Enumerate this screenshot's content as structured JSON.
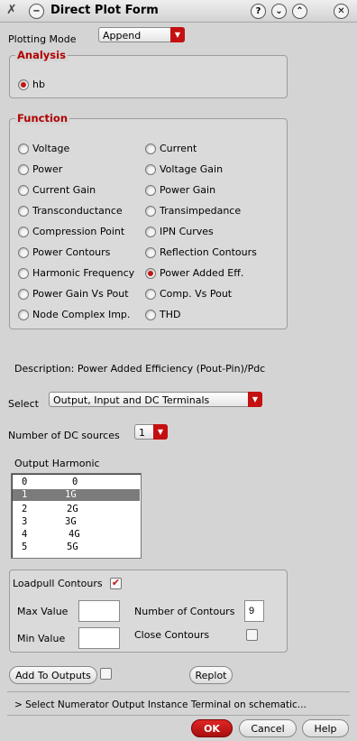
{
  "window": {
    "title": "Direct Plot Form",
    "help_icon": "?",
    "down_icon": "⌄",
    "up_icon": "⌃",
    "close_icon": "✕"
  },
  "plotting_mode": {
    "label": "Plotting Mode",
    "value": "Append"
  },
  "analysis": {
    "title": "Analysis",
    "options": [
      {
        "label": "hb",
        "selected": true
      }
    ]
  },
  "function": {
    "title": "Function",
    "left": [
      {
        "label": "Voltage",
        "selected": false
      },
      {
        "label": "Power",
        "selected": false
      },
      {
        "label": "Current Gain",
        "selected": false
      },
      {
        "label": "Transconductance",
        "selected": false
      },
      {
        "label": "Compression Point",
        "selected": false
      },
      {
        "label": "Power Contours",
        "selected": false
      },
      {
        "label": "Harmonic Frequency",
        "selected": false
      },
      {
        "label": "Power Gain Vs Pout",
        "selected": false
      },
      {
        "label": "Node Complex Imp.",
        "selected": false
      }
    ],
    "right": [
      {
        "label": "Current",
        "selected": false
      },
      {
        "label": "Voltage Gain",
        "selected": false
      },
      {
        "label": "Power Gain",
        "selected": false
      },
      {
        "label": "Transimpedance",
        "selected": false
      },
      {
        "label": "IPN Curves",
        "selected": false
      },
      {
        "label": "Reflection Contours",
        "selected": false
      },
      {
        "label": "Power Added Eff.",
        "selected": true
      },
      {
        "label": "Comp. Vs Pout",
        "selected": false
      },
      {
        "label": "THD",
        "selected": false
      }
    ]
  },
  "description": "Description: Power Added Efficiency (Pout-Pin)/Pdc",
  "select": {
    "label": "Select",
    "value": "Output, Input and DC Terminals"
  },
  "dc_sources": {
    "label": "Number of DC sources",
    "value": "1"
  },
  "output_harmonic": {
    "label": "Output Harmonic",
    "rows": [
      {
        "index": "0",
        "value": "0",
        "selected": false
      },
      {
        "index": "1",
        "value": "1G",
        "selected": true
      },
      {
        "index": "2",
        "value": "2G",
        "selected": false
      },
      {
        "index": "3",
        "value": "3G",
        "selected": false
      },
      {
        "index": "4",
        "value": "4G",
        "selected": false
      },
      {
        "index": "5",
        "value": "5G",
        "selected": false
      }
    ]
  },
  "loadpull": {
    "label": "Loadpull Contours",
    "checked": true,
    "max_value_label": "Max Value",
    "max_value": "",
    "min_value_label": "Min Value",
    "min_value": "",
    "num_contours_label": "Number of Contours",
    "num_contours": "9",
    "close_contours_label": "Close Contours",
    "close_contours": false
  },
  "buttons": {
    "add_to_outputs": "Add To Outputs",
    "replot": "Replot",
    "ok": "OK",
    "cancel": "Cancel",
    "help": "Help"
  },
  "status": "> Select Numerator Output Instance Terminal on schematic..."
}
